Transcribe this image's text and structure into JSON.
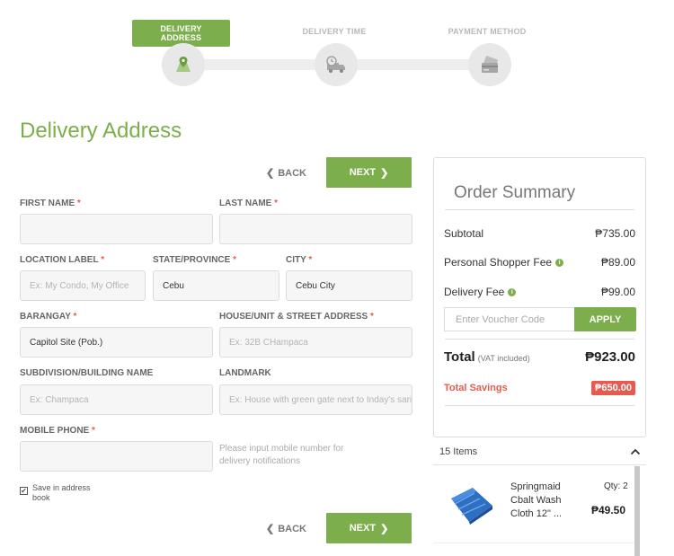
{
  "stepper": {
    "steps": [
      {
        "label": "DELIVERY ADDRESS",
        "icon": "map-pin-icon",
        "active": true
      },
      {
        "label": "DELIVERY TIME",
        "icon": "delivery-truck-clock-icon",
        "active": false
      },
      {
        "label": "PAYMENT METHOD",
        "icon": "credit-card-icon",
        "active": false
      }
    ]
  },
  "page_title": "Delivery Address",
  "nav": {
    "back_label": "BACK",
    "next_label": "NEXT"
  },
  "form": {
    "first_name": {
      "label": "FIRST NAME",
      "required": "*",
      "value": ""
    },
    "last_name": {
      "label": "LAST NAME",
      "required": "*",
      "value": ""
    },
    "location_label": {
      "label": "LOCATION LABEL",
      "required": "*",
      "placeholder": "Ex: My Condo, My Office"
    },
    "state_province": {
      "label": "STATE/PROVINCE",
      "required": "*",
      "value": "Cebu"
    },
    "city": {
      "label": "CITY",
      "required": "*",
      "value": "Cebu City"
    },
    "barangay": {
      "label": "BARANGAY",
      "required": "*",
      "value": "Capitol Site (Pob.)"
    },
    "house_street": {
      "label": "HOUSE/UNIT & STREET ADDRESS",
      "required": "*",
      "placeholder": "Ex: 32B CHampaca"
    },
    "subdivision": {
      "label": "SUBDIVISION/BUILDING NAME",
      "placeholder": "Ex: Champaca"
    },
    "landmark": {
      "label": "LANDMARK",
      "placeholder": "Ex: House with green gate next to Inday's sari-sari store"
    },
    "mobile_phone": {
      "label": "MOBILE PHONE",
      "required": "*",
      "value": ""
    },
    "mobile_hint": "Please input mobile number for delivery notifications",
    "save_address": {
      "label": "Save in address book",
      "checked": true
    }
  },
  "summary": {
    "title": "Order Summary",
    "subtotal_label": "Subtotal",
    "subtotal_value": "₱735.00",
    "shopper_fee_label": "Personal Shopper Fee",
    "shopper_fee_value": "₱89.00",
    "delivery_fee_label": "Delivery Fee",
    "delivery_fee_value": "₱99.00",
    "voucher_placeholder": "Enter Voucher Code",
    "apply_label": "APPLY",
    "total_label": "Total",
    "vat_note": "(VAT included)",
    "total_value": "₱923.00",
    "savings_label": "Total Savings",
    "savings_value": "₱650.00"
  },
  "items": {
    "count_label": "15 Items",
    "list": [
      {
        "name": "Springmaid Cbalt Wash Cloth 12\" ...",
        "qty": "Qty: 2",
        "price": "₱49.50"
      }
    ]
  },
  "colors": {
    "accent": "#7cae4c",
    "danger": "#e85a4f"
  }
}
